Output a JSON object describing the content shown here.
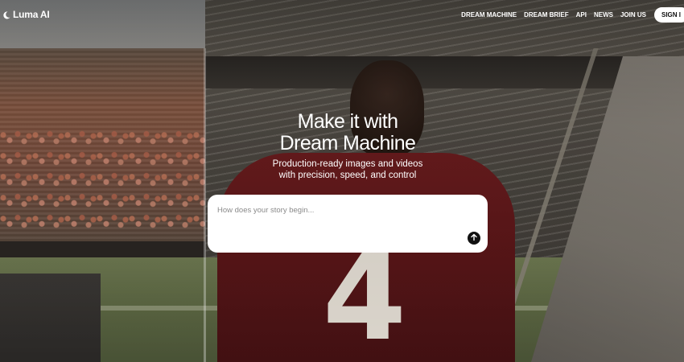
{
  "brand": {
    "name": "Luma AI",
    "icon": "luma-logo-icon"
  },
  "nav": {
    "items": [
      {
        "label": "DREAM MACHINE"
      },
      {
        "label": "DREAM BRIEF"
      },
      {
        "label": "API"
      },
      {
        "label": "NEWS"
      },
      {
        "label": "JOIN US"
      }
    ],
    "signin_label": "SIGN I"
  },
  "hero": {
    "title_line1": "Make it with",
    "title_line2": "Dream Machine",
    "subtitle_line1": "Production-ready images and videos",
    "subtitle_line2": "with precision, speed, and control"
  },
  "prompt": {
    "placeholder": "How does your story begin...",
    "value": "",
    "send_icon": "arrow-up-icon"
  },
  "background": {
    "jersey_number": "4",
    "jersey_color": "#5a1618"
  }
}
